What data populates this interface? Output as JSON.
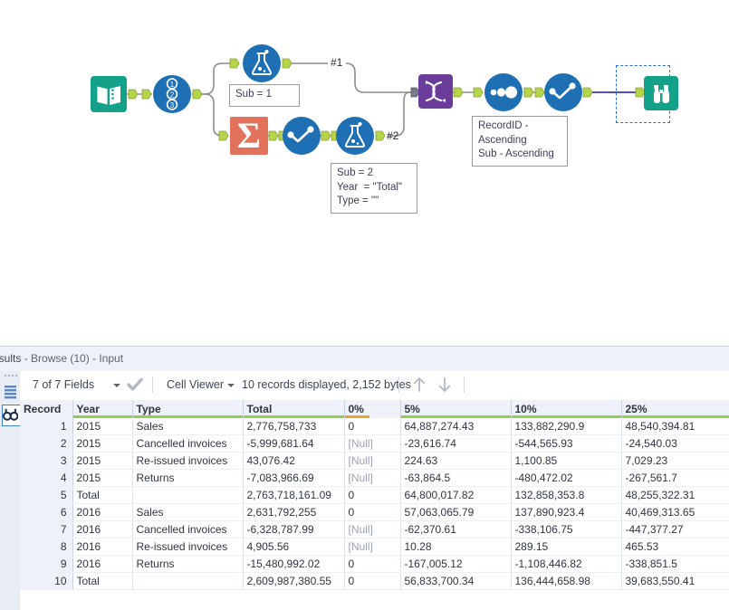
{
  "workflow": {
    "tools": [
      {
        "id": "input-data",
        "name": "input-data-tool",
        "label": "Input Data"
      },
      {
        "id": "record-id",
        "name": "record-id-tool",
        "label": "Record ID"
      },
      {
        "id": "formula-1",
        "name": "formula-tool",
        "label": "Formula"
      },
      {
        "id": "summarize",
        "name": "summarize-tool",
        "label": "Summarize"
      },
      {
        "id": "select",
        "name": "select-tool",
        "label": "Select"
      },
      {
        "id": "formula-2",
        "name": "formula-tool",
        "label": "Formula"
      },
      {
        "id": "union",
        "name": "union-tool",
        "label": "Union"
      },
      {
        "id": "sort",
        "name": "sort-tool",
        "label": "Sort"
      },
      {
        "id": "select-2",
        "name": "select-tool",
        "label": "Select"
      },
      {
        "id": "browse",
        "name": "browse-tool",
        "label": "Browse"
      }
    ],
    "annotations": {
      "formula_1": "Sub = 1",
      "formula_2": "Sub = 2\nYear  = \"Total\"\nType = \"\"",
      "sort": "RecordID -\nAscending\nSub - Ascending"
    },
    "connection_labels": {
      "union_input_1": "#1",
      "union_input_2": "#2"
    },
    "colors": {
      "input_teal": "#13a18a",
      "browse_teal": "#13a18a",
      "tool_blue": "#1f6fb4",
      "summarize_orange": "#e2725b",
      "union_purple": "#6a3d9a",
      "connector_green": "#b5d44a",
      "wire_gray": "#8c8c8c",
      "wire_selected": "#3a32c8",
      "selection_border": "#2a6bd4"
    }
  },
  "results": {
    "title_prefix": "esults",
    "title_suffix": " - Browse (10) - Input",
    "toolbar": {
      "fields_label": "7 of 7 Fields",
      "view_label": "Cell Viewer",
      "records_label": "10 records displayed, 2,152 bytes",
      "check_icon": "checkmark-icon",
      "up_icon": "arrow-up-icon",
      "down_icon": "arrow-down-icon"
    },
    "rail": {
      "list_icon": "list-icon",
      "browse_icon": "binoculars-icon"
    },
    "table": {
      "columns": [
        {
          "label": "Record",
          "quality": "none"
        },
        {
          "label": "Year",
          "quality": "green"
        },
        {
          "label": "Type",
          "quality": "green"
        },
        {
          "label": "Total",
          "quality": "green"
        },
        {
          "label": "0%",
          "quality": "orange"
        },
        {
          "label": "5%",
          "quality": "green"
        },
        {
          "label": "10%",
          "quality": "green"
        },
        {
          "label": "25%",
          "quality": "green"
        }
      ],
      "rows": [
        {
          "record": "1",
          "year": "2015",
          "type": "Sales",
          "total": "2,776,758,733",
          "p0": "0",
          "p5": "64,887,274.43",
          "p10": "133,882,290.9",
          "p25": "48,540,394.81"
        },
        {
          "record": "2",
          "year": "2015",
          "type": "Cancelled invoices",
          "total": "-5,999,681.64",
          "p0": "[Null]",
          "p5": "-23,616.74",
          "p10": "-544,565.93",
          "p25": "-24,540.03"
        },
        {
          "record": "3",
          "year": "2015",
          "type": "Re-issued invoices",
          "total": "43,076.42",
          "p0": "[Null]",
          "p5": "224.63",
          "p10": "1,100.85",
          "p25": "7,029.23"
        },
        {
          "record": "4",
          "year": "2015",
          "type": "Returns",
          "total": "-7,083,966.69",
          "p0": "[Null]",
          "p5": "-63,864.5",
          "p10": "-480,472.02",
          "p25": "-267,561.7"
        },
        {
          "record": "5",
          "year": "Total",
          "type": "",
          "total": "2,763,718,161.09",
          "p0": "0",
          "p5": "64,800,017.82",
          "p10": "132,858,353.8",
          "p25": "48,255,322.31"
        },
        {
          "record": "6",
          "year": "2016",
          "type": "Sales",
          "total": "2,631,792,255",
          "p0": "0",
          "p5": "57,063,065.79",
          "p10": "137,890,923.4",
          "p25": "40,469,313.65"
        },
        {
          "record": "7",
          "year": "2016",
          "type": "Cancelled invoices",
          "total": "-6,328,787.99",
          "p0": "[Null]",
          "p5": "-62,370.61",
          "p10": "-338,106.75",
          "p25": "-447,377.27"
        },
        {
          "record": "8",
          "year": "2016",
          "type": "Re-issued invoices",
          "total": "4,905.56",
          "p0": "[Null]",
          "p5": "10.28",
          "p10": "289.15",
          "p25": "465.53"
        },
        {
          "record": "9",
          "year": "2016",
          "type": "Returns",
          "total": "-15,480,992.02",
          "p0": "0",
          "p5": "-167,005.12",
          "p10": "-1,108,446.82",
          "p25": "-338,851.5"
        },
        {
          "record": "10",
          "year": "Total",
          "type": "",
          "total": "2,609,987,380.55",
          "p0": "0",
          "p5": "56,833,700.34",
          "p10": "136,444,658.98",
          "p25": "39,683,550.41"
        }
      ]
    }
  }
}
